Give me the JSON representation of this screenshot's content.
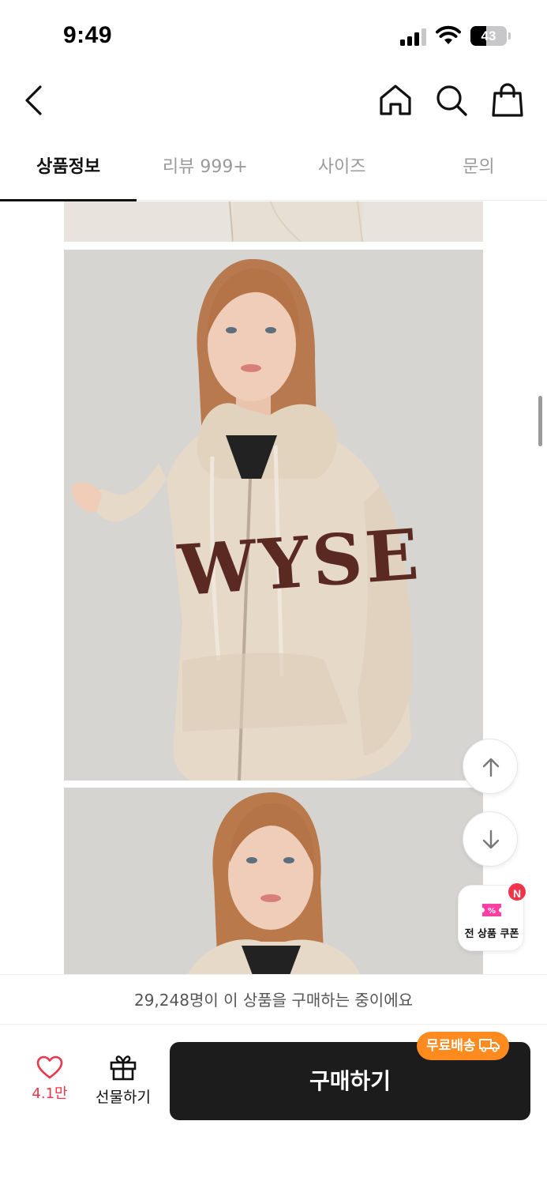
{
  "status_bar": {
    "time": "9:49",
    "battery": "43"
  },
  "header": {
    "icons": [
      "chevron-left-icon",
      "home-icon",
      "search-icon",
      "shopping-bag-icon"
    ]
  },
  "tabs": [
    {
      "label": "상품정보",
      "active": true
    },
    {
      "label": "리뷰 999+",
      "active": false
    },
    {
      "label": "사이즈",
      "active": false
    },
    {
      "label": "문의",
      "active": false
    }
  ],
  "product_images": {
    "print_text": "WYSE"
  },
  "floating": {
    "coupon_label": "전 상품 쿠폰",
    "new_badge": "N"
  },
  "purchase_bar": {
    "text": "29,248명이 이 상품을 구매하는 중이에요"
  },
  "bottom_bar": {
    "like_count": "4.1만",
    "gift_label": "선물하기",
    "buy_label": "구매하기",
    "free_shipping": "무료배송"
  },
  "colors": {
    "accent_red": "#f0344a",
    "shipping_orange": "#ff8a1e",
    "buy_button": "#1c1c1c",
    "hoodie_beige": "#e8dccb",
    "print_brown": "#5a2a22"
  }
}
